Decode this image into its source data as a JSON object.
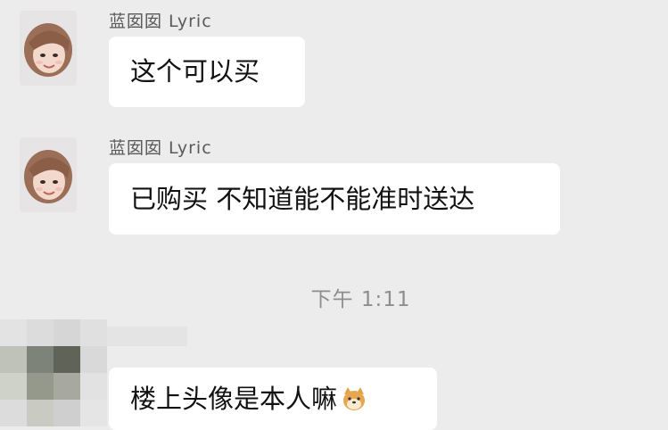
{
  "chat": {
    "messages": [
      {
        "sender": "蓝囡囡 Lyric",
        "text": "这个可以买"
      },
      {
        "sender": "蓝囡囡 Lyric",
        "text": "已购买 不知道能不能准时送达"
      }
    ],
    "timestamp": "下午 1:11",
    "reply": {
      "text": "楼上头像是本人嘛",
      "emoji": "shiba-dog-emoji"
    }
  },
  "colors": {
    "background": "#ececec",
    "bubble": "#ffffff",
    "name_text": "#5a5a5a",
    "time_text": "#8e8e8e"
  }
}
